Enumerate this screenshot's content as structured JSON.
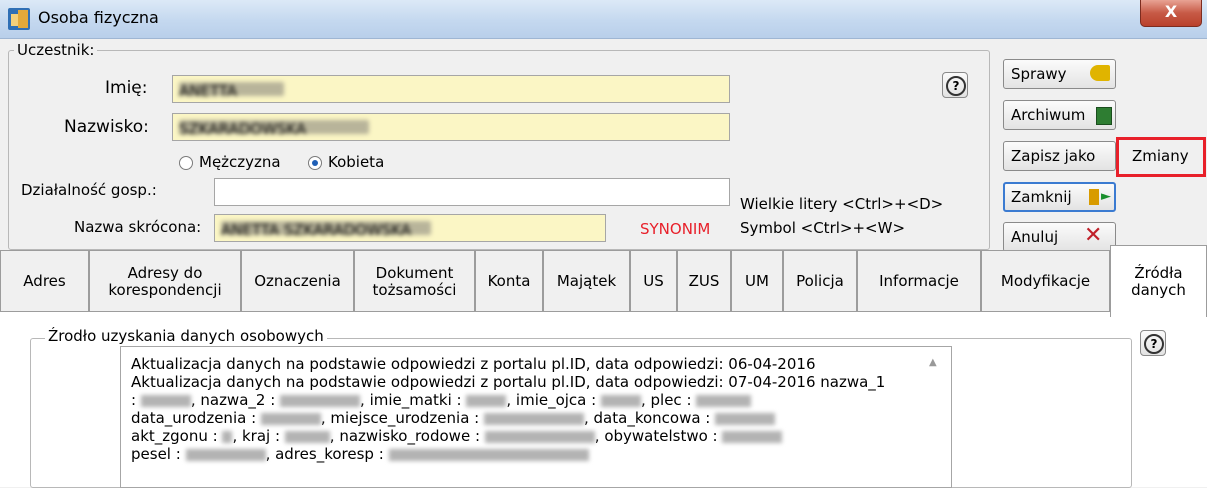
{
  "window": {
    "title": "Osoba fizyczna",
    "close_glyph": "X"
  },
  "participant": {
    "group_label": "Uczestnik:",
    "first_name_label": "Imię:",
    "first_name_value": "ANETTA",
    "last_name_label": "Nazwisko:",
    "last_name_value": "SZKARADOWSKA",
    "gender_male": "Mężczyzna",
    "gender_female": "Kobieta",
    "gender_selected": "Kobieta",
    "business_label": "Działalność gosp.:",
    "business_value": "",
    "short_name_label": "Nazwa skrócona:",
    "short_name_value": "ANETTA SZKARADOWSKA",
    "synonym": "SYNONIM",
    "hint_upper": "Wielkie litery <Ctrl>+<D>",
    "hint_symbol": "Symbol <Ctrl>+<W>"
  },
  "buttons": {
    "sprawy": "Sprawy",
    "archiwum": "Archiwum",
    "zapisz_jako": "Zapisz jako",
    "zmiany": "Zmiany",
    "zamknij": "Zamknij",
    "anuluj": "Anuluj",
    "help": "?"
  },
  "tabs": [
    {
      "label": "Adres"
    },
    {
      "label": "Adresy do korespondencji"
    },
    {
      "label": "Oznaczenia"
    },
    {
      "label": "Dokument tożsamości"
    },
    {
      "label": "Konta"
    },
    {
      "label": "Majątek"
    },
    {
      "label": "US"
    },
    {
      "label": "ZUS"
    },
    {
      "label": "UM"
    },
    {
      "label": "Policja"
    },
    {
      "label": "Informacje"
    },
    {
      "label": "Modyfikacje"
    },
    {
      "label": "Źródła danych"
    }
  ],
  "source_panel": {
    "group_label": "Źrodło uzyskania danych osobowych",
    "lines": [
      "Aktualizacja danych na podstawie odpowiedzi z portalu pl.ID, data odpowiedzi: 06-04-2016",
      "Aktualizacja danych na podstawie odpowiedzi z portalu pl.ID, data odpowiedzi: 07-04-2016 nazwa_1",
      ": ",
      ", nazwa_2 : ",
      ", imie_matki : ",
      ", imie_ojca : ",
      ", plec : ",
      "data_urodzenia : ",
      ", miejsce_urodzenia : ",
      ", data_koncowa : ",
      "akt_zgonu : ",
      ", kraj : ",
      ", nazwisko_rodowe : ",
      ", obywatelstwo : ",
      "pesel : ",
      ", adres_koresp : "
    ]
  },
  "colors": {
    "highlight_red": "#e8202a",
    "synonym": "#e8202a",
    "input_yellow": "#fbf6c5"
  }
}
